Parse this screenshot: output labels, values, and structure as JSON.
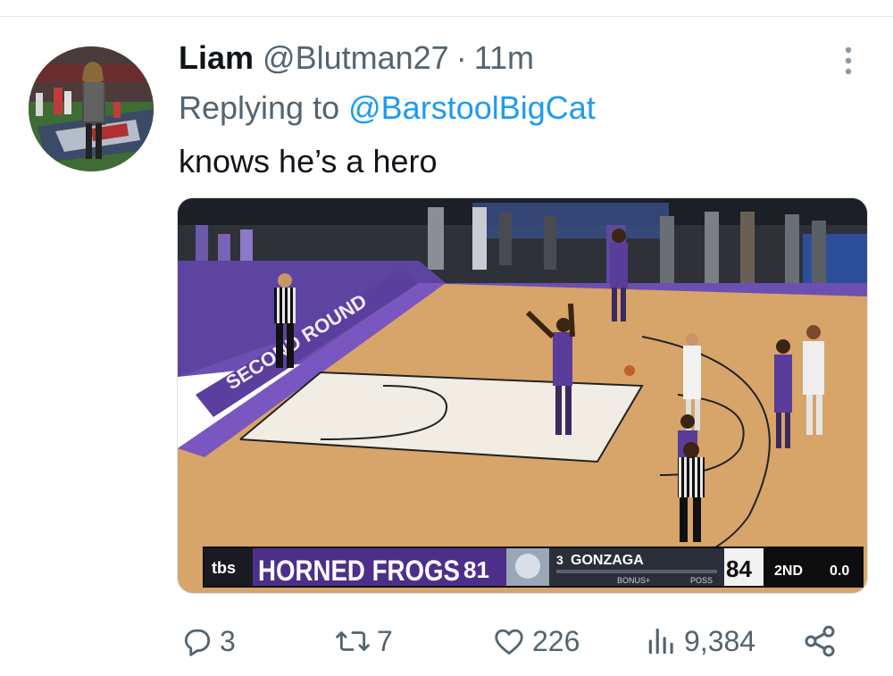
{
  "tweet": {
    "display_name": "Liam",
    "handle": "@Blutman27",
    "separator": "·",
    "time": "11m",
    "replying_prefix": "Replying to",
    "replying_to": "@BarstoolBigCat",
    "text": "knows he’s a hero"
  },
  "media": {
    "scorebug": {
      "network": "tbs",
      "team1_name": "HORNED FROGS",
      "team1_score": "81",
      "team2_seed": "3",
      "team2_name": "GONZAGA",
      "team2_score": "84",
      "bonus_label": "BONUS+",
      "poss_label": "POSS",
      "period": "2ND",
      "clock": "0.0"
    },
    "court_text": "SECOND ROUND"
  },
  "actions": {
    "replies": "3",
    "retweets": "7",
    "likes": "226",
    "views": "9,384"
  },
  "colors": {
    "link": "#1d9bf0",
    "secondary_text": "#536471",
    "primary_text": "#0f1419"
  },
  "icons": [
    "more-icon",
    "reply-icon",
    "retweet-icon",
    "like-icon",
    "views-icon",
    "share-icon"
  ]
}
